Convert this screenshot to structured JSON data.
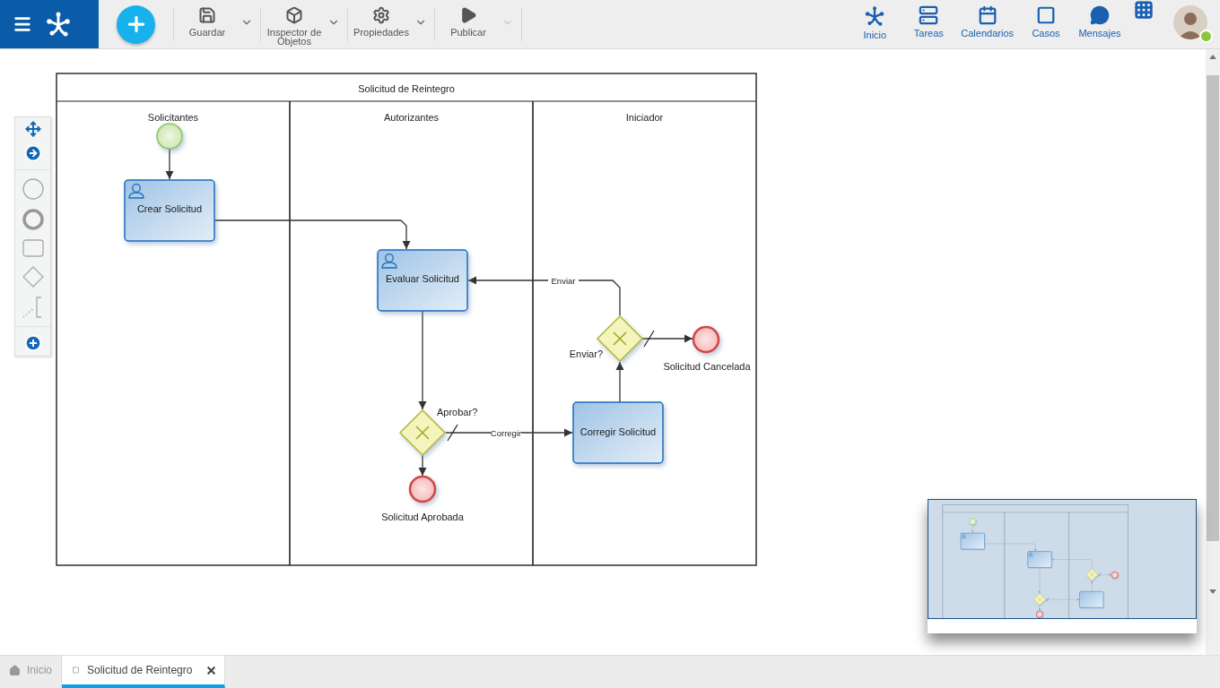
{
  "toolbar": {
    "actions": [
      {
        "label": "Guardar",
        "kind": "save",
        "menu_disabled": false
      },
      {
        "label": "Inspector de Objetos",
        "kind": "inspect",
        "menu_disabled": false
      },
      {
        "label": "Propiedades",
        "kind": "properties",
        "menu_disabled": false
      },
      {
        "label": "Publicar",
        "kind": "publish",
        "menu_disabled": true
      }
    ],
    "nav": [
      {
        "label": "Inicio",
        "kind": "home"
      },
      {
        "label": "Tareas",
        "kind": "tasks"
      },
      {
        "label": "Calendarios",
        "kind": "calendar"
      },
      {
        "label": "Casos",
        "kind": "cases"
      },
      {
        "label": "Mensajes",
        "kind": "messages"
      }
    ],
    "user": {
      "online": true
    }
  },
  "diagram": {
    "pool_title": "Solicitud de Reintegro",
    "lanes": [
      {
        "label": "Solicitantes"
      },
      {
        "label": "Autorizantes"
      },
      {
        "label": "Iniciador"
      }
    ],
    "nodes": [
      {
        "kind": "start"
      },
      {
        "kind": "task",
        "label": "Crear Solicitud",
        "user_task": true
      },
      {
        "kind": "task",
        "label": "Evaluar Solicitud",
        "user_task": true
      },
      {
        "kind": "gateway",
        "label": "Enviar?"
      },
      {
        "kind": "end",
        "label": "Solicitud Cancelada"
      },
      {
        "kind": "task",
        "label": "Corregir Solicitud",
        "user_task": false
      },
      {
        "kind": "gateway",
        "label": "Aprobar?"
      },
      {
        "kind": "end",
        "label": "Solicitud Aprobada"
      }
    ],
    "flows": [
      {
        "default": false
      },
      {
        "default": false
      },
      {
        "default": false
      },
      {
        "default": false
      },
      {
        "label": "Corregir",
        "default": true
      },
      {
        "default": false
      },
      {
        "label": "Enviar",
        "default": false
      },
      {
        "default": true
      }
    ]
  },
  "tabs": [
    {
      "label": "Inicio",
      "kind": "home",
      "selected": false,
      "closable": false
    },
    {
      "label": "Solicitud de Reintegro",
      "kind": "diagram",
      "selected": true,
      "closable": true
    }
  ]
}
